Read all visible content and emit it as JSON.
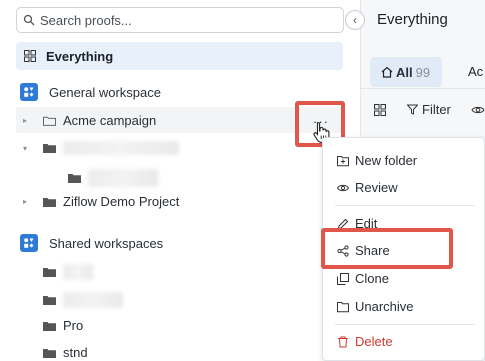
{
  "sidebar": {
    "search_placeholder": "Search proofs...",
    "everything_label": "Everything",
    "general_workspace": "General workspace",
    "acme_campaign": "Acme campaign",
    "ziflow_demo": "Ziflow Demo Project",
    "shared_workspaces": "Shared workspaces",
    "pro": "Pro",
    "stnd": "stnd"
  },
  "main": {
    "title": "Everything",
    "tab_all": "All",
    "tab_all_count": "99",
    "tab_next": "Ac",
    "filter_label": "Filter"
  },
  "menu": {
    "items": [
      "New folder",
      "Review",
      "Edit",
      "Share",
      "Clone",
      "Unarchive",
      "Delete"
    ]
  },
  "colors": {
    "accent": "#2d7ad7",
    "highlight": "#e0564a",
    "delete": "#d23a2e"
  }
}
